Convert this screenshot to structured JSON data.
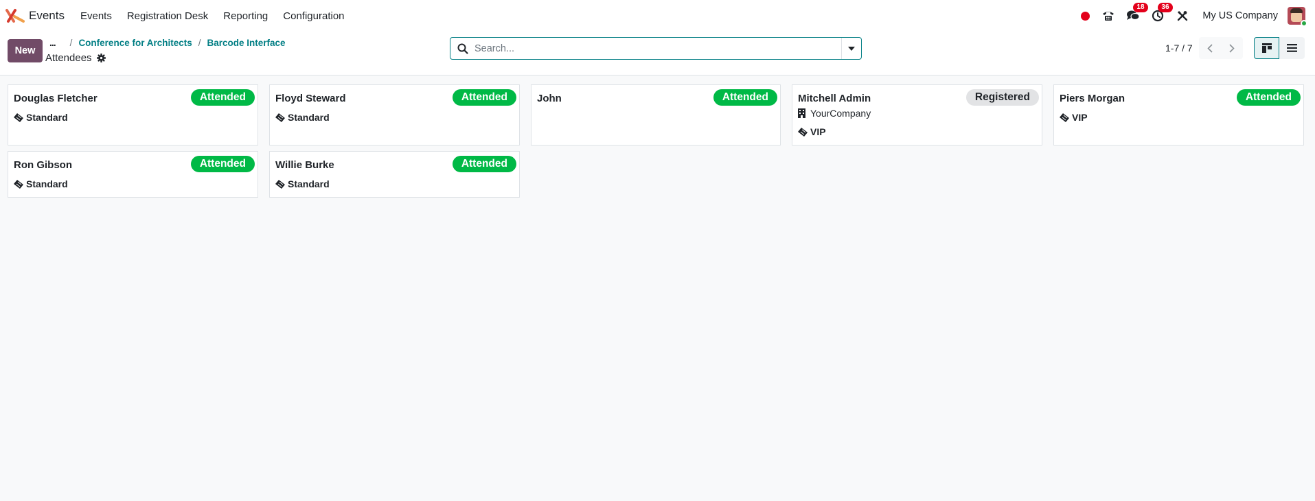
{
  "navbar": {
    "app_name": "Events",
    "menu": [
      {
        "label": "Events"
      },
      {
        "label": "Registration Desk"
      },
      {
        "label": "Reporting"
      },
      {
        "label": "Configuration"
      }
    ],
    "messages_badge": "18",
    "activities_badge": "36",
    "company": "My US Company"
  },
  "control": {
    "new_label": "New",
    "breadcrumb_ellipsis": "...",
    "breadcrumbs": [
      {
        "label": "Conference for Architects"
      },
      {
        "label": "Barcode Interface"
      }
    ],
    "title": "Attendees",
    "search_placeholder": "Search...",
    "pager": "1-7 / 7"
  },
  "attendees": [
    {
      "name": "Douglas Fletcher",
      "status": "Attended",
      "ticket": "Standard"
    },
    {
      "name": "Floyd Steward",
      "status": "Attended",
      "ticket": "Standard"
    },
    {
      "name": "John",
      "status": "Attended"
    },
    {
      "name": "Mitchell Admin",
      "status": "Registered",
      "company": "YourCompany",
      "ticket": "VIP"
    },
    {
      "name": "Piers Morgan",
      "status": "Attended",
      "ticket": "VIP"
    },
    {
      "name": "Ron Gibson",
      "status": "Attended",
      "ticket": "Standard"
    },
    {
      "name": "Willie Burke",
      "status": "Attended",
      "ticket": "Standard"
    }
  ],
  "colors": {
    "brand": "#714b67",
    "accent": "#017e84",
    "attended": "#00b946",
    "registered": "#e2e3e5",
    "badge": "#e3001b"
  }
}
